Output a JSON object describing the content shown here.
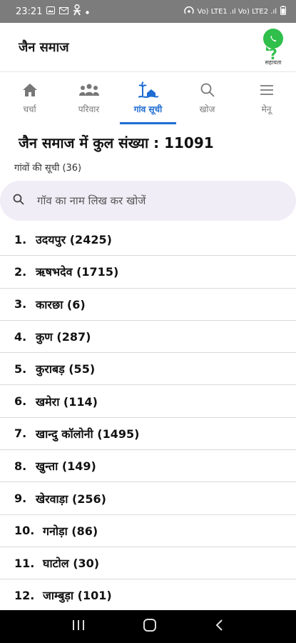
{
  "status": {
    "time": "23:21",
    "network": "Vo) LTE1 .ıl Vo) LTE2 .ıl"
  },
  "app": {
    "title": "जैन समाज",
    "help_label": "सहायता"
  },
  "tabs": [
    {
      "label": "चर्चा",
      "icon": "home-icon"
    },
    {
      "label": "परिवार",
      "icon": "family-icon"
    },
    {
      "label": "गांव सूची",
      "icon": "village-icon",
      "active": true
    },
    {
      "label": "खोज",
      "icon": "search-icon"
    },
    {
      "label": "मेनू",
      "icon": "menu-icon"
    }
  ],
  "summary": {
    "title": "जैन समाज में कुल संख्या : 11091",
    "list_count": "गांवों की सूची (36)"
  },
  "search": {
    "placeholder": "गॉव का नाम लिख कर खोजें"
  },
  "villages": [
    {
      "no": "1.",
      "name": "उदयपुर (2425)"
    },
    {
      "no": "2.",
      "name": "ऋषभदेव (1715)"
    },
    {
      "no": "3.",
      "name": "कारछा (6)"
    },
    {
      "no": "4.",
      "name": "कुण (287)"
    },
    {
      "no": "5.",
      "name": "कुराबड़ (55)"
    },
    {
      "no": "6.",
      "name": "खमेरा (114)"
    },
    {
      "no": "7.",
      "name": "खान्दु कॉलोनी (1495)"
    },
    {
      "no": "8.",
      "name": "खुन्ता (149)"
    },
    {
      "no": "9.",
      "name": "खेरवाड़ा (256)"
    },
    {
      "no": "10.",
      "name": "गनोड़ा (86)"
    },
    {
      "no": "11.",
      "name": "घाटोल (30)"
    },
    {
      "no": "12.",
      "name": "जाम्बुड़ा (101)"
    }
  ],
  "colors": {
    "accent": "#1e6dd1",
    "whatsapp": "#2fbf4a",
    "search_bg": "#f1edf6"
  }
}
